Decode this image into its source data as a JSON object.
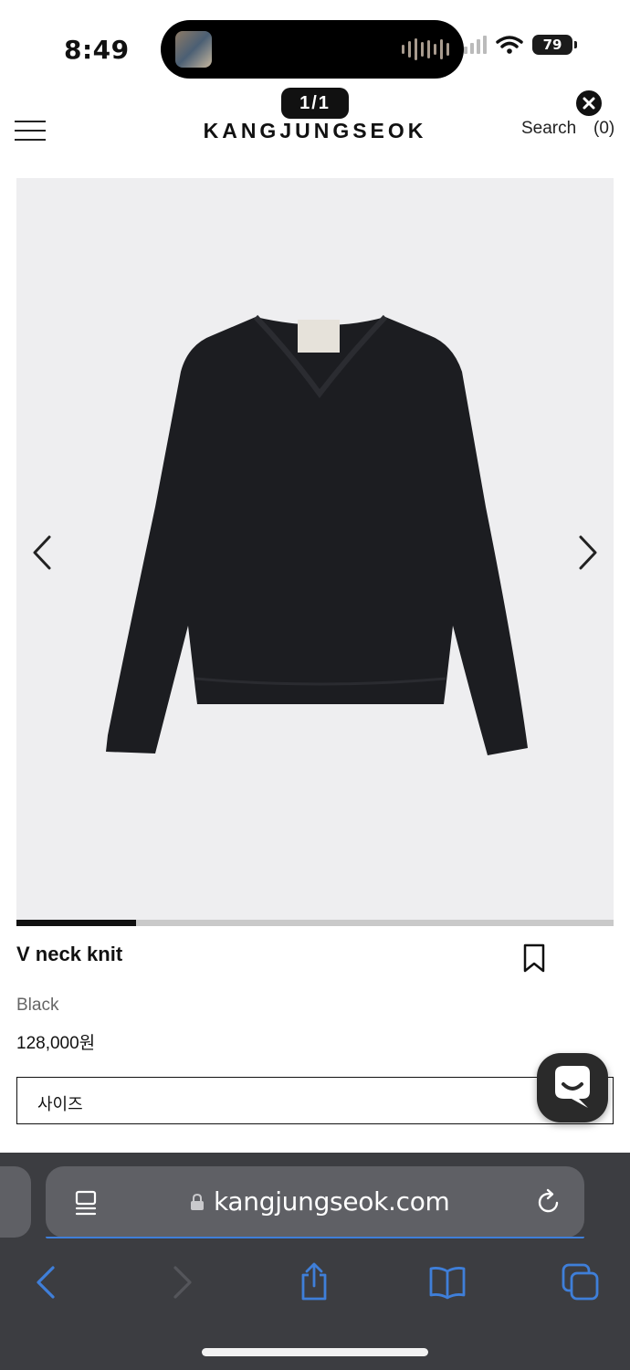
{
  "status_bar": {
    "time": "8:49",
    "battery": "79"
  },
  "page_indicator": "1/1",
  "header": {
    "brand": "KANGJUNGSEOK",
    "search_label": "Search",
    "cart_count": "(0)"
  },
  "carousel": {
    "progress": 0.2
  },
  "product": {
    "name": "V neck knit",
    "color": "Black",
    "price": "128,000원",
    "size_placeholder": "사이즈"
  },
  "browser": {
    "url": "kangjungseok.com"
  },
  "colors": {
    "accent": "#3f7fd9",
    "toolbar_bg": "#3c3d41",
    "image_bg": "#eeeef0"
  }
}
